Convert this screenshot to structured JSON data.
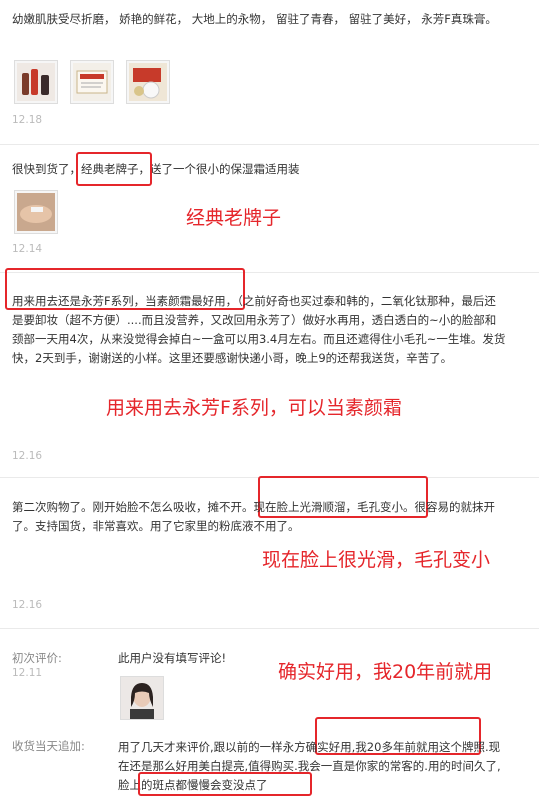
{
  "reviews": [
    {
      "text": "幼嫩肌肤受尽折磨，  娇艳的鲜花，  大地上的永物，  留驻了青春，  留驻了美好，  永芳F真珠膏。",
      "date": "12.18"
    },
    {
      "text": "很快到货了，经典老牌子，送了一个很小的保湿霜适用装",
      "date": "12.14",
      "annotation": "经典老牌子"
    },
    {
      "text": "用来用去还是永芳F系列，当素颜霜最好用，（之前好奇也买过泰和韩的，二氧化钛那种，最后还是要卸妆（超不方便）....而且没营养，又改回用永芳了）做好水再用，透白透白的~小的脸部和颈部一天用4次，从来没觉得会掉白~一盒可以用3.4月左右。而且还遮得住小毛孔~一生堆。发货快，2天到手，谢谢送的小样。这里还要感谢快递小哥，晚上9的还帮我送货，辛苦了。",
      "date": "12.16",
      "annotation": "用来用去永芳F系列，可以当素颜霜"
    },
    {
      "text": "第二次购物了。刚开始脸不怎么吸收，摊不开。现在脸上光滑顺溜，毛孔变小。很容易的就抹开了。支持国货，非常喜欢。用了它家里的粉底液不用了。",
      "date": "12.16",
      "annotation": "现在脸上很光滑，毛孔变小"
    }
  ],
  "last_review": {
    "initial_label": "初次评价:",
    "initial_date": "12.11",
    "initial_text": "此用户没有填写评论!",
    "annotation": "确实好用，我20年前就用",
    "followup_label": "收货当天追加:",
    "followup_text": "用了几天才来评价,跟以前的一样永方确实好用,我20多年前就用这个牌照.现在还是那么好用美白提亮,值得购买.我会一直是你家的常客的.用的时间久了,脸上的斑点都慢慢会变没点了"
  },
  "colors": {
    "annotation_red": "#e5262b",
    "date_gray": "#bbbbbb"
  },
  "thumbnails": [
    "product-bottles-photo",
    "product-box-photo",
    "product-jar-photo",
    "hand-sample-photo",
    "user-avatar-photo"
  ]
}
